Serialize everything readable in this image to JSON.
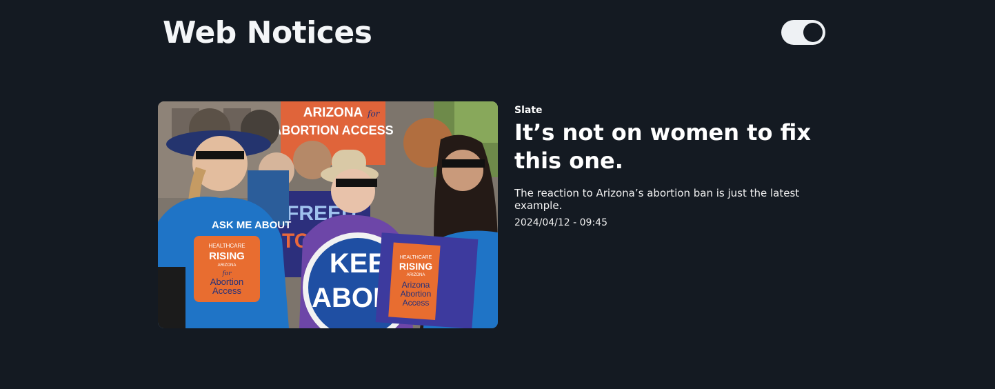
{
  "header": {
    "title": "Web Notices",
    "theme_toggle": {
      "state": "on"
    }
  },
  "notices": [
    {
      "source": "Slate",
      "headline": "It’s not on women to fix this one.",
      "summary": "The reaction to Arizona’s abortion ban is just the latest example.",
      "date": "2024/04/12 - 09:45",
      "image": {
        "sign_top_line1": "ARIZONA",
        "sign_top_for": "for",
        "sign_top_line2": "ABORTION ACCESS",
        "sign_left": "FREED",
        "sign_left2": "TO D",
        "shirt_left_top": "ASK ME ABOUT",
        "shirt_left_1": "HEALTHCARE",
        "shirt_left_2": "RISING",
        "shirt_left_3": "ARIZONA",
        "shirt_left_4": "for",
        "shirt_left_5": "Abortion",
        "shirt_left_6": "Access",
        "round_sign_1": "KEE",
        "round_sign_2": "ABOR",
        "card_1": "HEALTHCARE",
        "card_2": "RISING",
        "card_3": "ARIZONA",
        "card_4": "Arizona",
        "card_5": "Abortion",
        "card_6": "Access"
      }
    }
  ],
  "colors": {
    "background": "#141a22",
    "text": "#ffffff",
    "toggle_track": "#eef1f4"
  }
}
